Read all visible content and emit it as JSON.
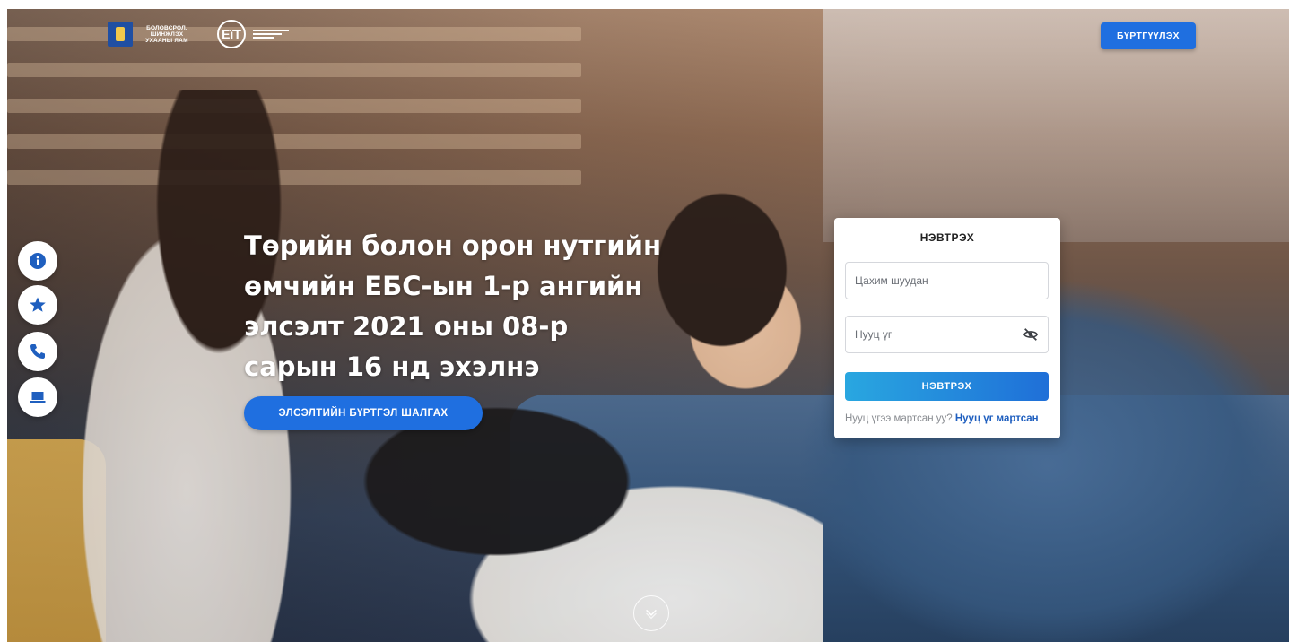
{
  "header": {
    "ministry_text": "БОЛОВСРОЛ, ШИНЖЛЭХ УХААНЫ ЯАМ",
    "eit_logo_text": "ЕїТ",
    "register_label": "БҮРТГҮҮЛЭХ"
  },
  "side_buttons": [
    {
      "icon": "info-icon"
    },
    {
      "icon": "star-icon"
    },
    {
      "icon": "phone-icon"
    },
    {
      "icon": "laptop-icon"
    }
  ],
  "hero": {
    "headline": "Төрийн болон орон нутгийн өмчийн ЕБС-ын 1-р ангийн элсэлт 2021 оны 08-р сарын 16 нд эхэлнэ",
    "check_button_label": "ЭЛСЭЛТИЙН БҮРТГЭЛ ШАЛГАХ"
  },
  "login": {
    "title": "НЭВТРЭХ",
    "email_placeholder": "Цахим шуудан",
    "email_value": "",
    "password_placeholder": "Нууц үг",
    "password_value": "",
    "submit_label": "НЭВТРЭХ",
    "forgot_question": "Нууц үгээ мартсан уу?",
    "forgot_link": "Нууц үг мартсан"
  },
  "colors": {
    "accent": "#1f6fe0",
    "side_icon": "#1f5fbf",
    "link": "#1f5fbf"
  }
}
